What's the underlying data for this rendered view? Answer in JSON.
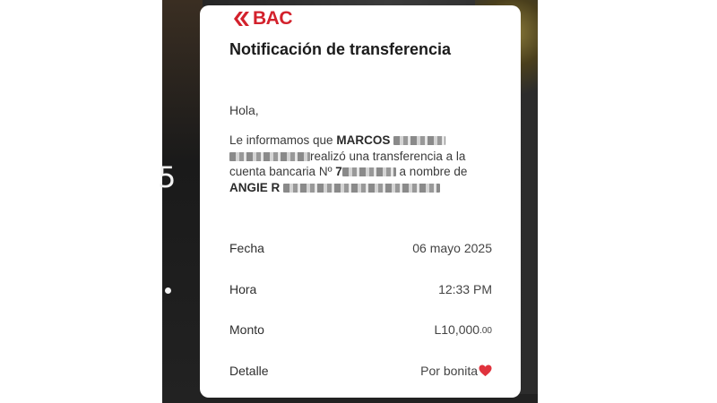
{
  "brand": {
    "name": "BAC",
    "color": "#d3212c"
  },
  "background": {
    "side_glyph": "5"
  },
  "notification": {
    "title": "Notificación de transferencia",
    "greeting": "Hola,",
    "message": {
      "line1_prefix": "Le informamos que",
      "sender_first": "MARCOS",
      "line2_suffix": "realizó una transferencia a la",
      "line3_prefix": "cuenta bancaria Nº",
      "account_visible": "7",
      "line3_suffix": "a nombre de",
      "recipient_first": "ANGIE R"
    },
    "details": [
      {
        "label": "Fecha",
        "value": "06 mayo 2025"
      },
      {
        "label": "Hora",
        "value": "12:33 PM"
      },
      {
        "label": "Monto",
        "value_main": "L10,000",
        "value_cents": ".00"
      },
      {
        "label": "Detalle",
        "value": "Por bonita",
        "icon": "red-heart-icon"
      }
    ]
  }
}
